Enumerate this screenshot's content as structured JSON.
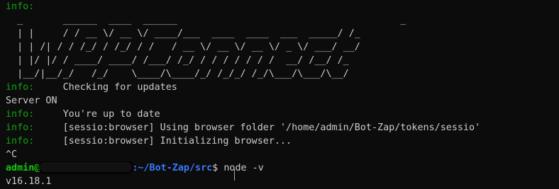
{
  "lines": [
    {
      "tag": "info:",
      "text": ""
    },
    {
      "art": "  _       ______  ____  ______                                       _  "
    },
    {
      "art": "  | |     / / __ \\/ __ \\/ ____/___  ____  ____  ___  _____/ /_ "
    },
    {
      "art": "  | | /| / / /_/ / /_/ / /   / __ \\/ __ \\/ __ \\/ _ \\/ ___/ __/"
    },
    {
      "art": "  | |/ |/ / ____/ ____/ /___/ /_/ / / / / / / /  __/ /__/ /_  "
    },
    {
      "art": "  |__/|__/_/   /_/    \\____/\\____/_/ /_/_/ /_/\\___/\\___/\\__/  "
    },
    {
      "tag": "info:",
      "text": "     Checking for updates"
    },
    {
      "plain": "Server ON"
    },
    {
      "tag": "info:",
      "text": "     You're up to date"
    },
    {
      "tag": "info:",
      "text": "     [sessio:browser] Using browser folder '/home/admin/Bot-Zap/tokens/sessio'"
    },
    {
      "tag": "info:",
      "text": "     [sessio:browser] Initializing browser..."
    },
    {
      "plain": "^C"
    },
    {
      "plain": "v16.18.1"
    }
  ],
  "prompt": {
    "user": "admin@",
    "path": ":~/Bot-Zap/src",
    "symbol": "$ ",
    "command": "node -v"
  }
}
